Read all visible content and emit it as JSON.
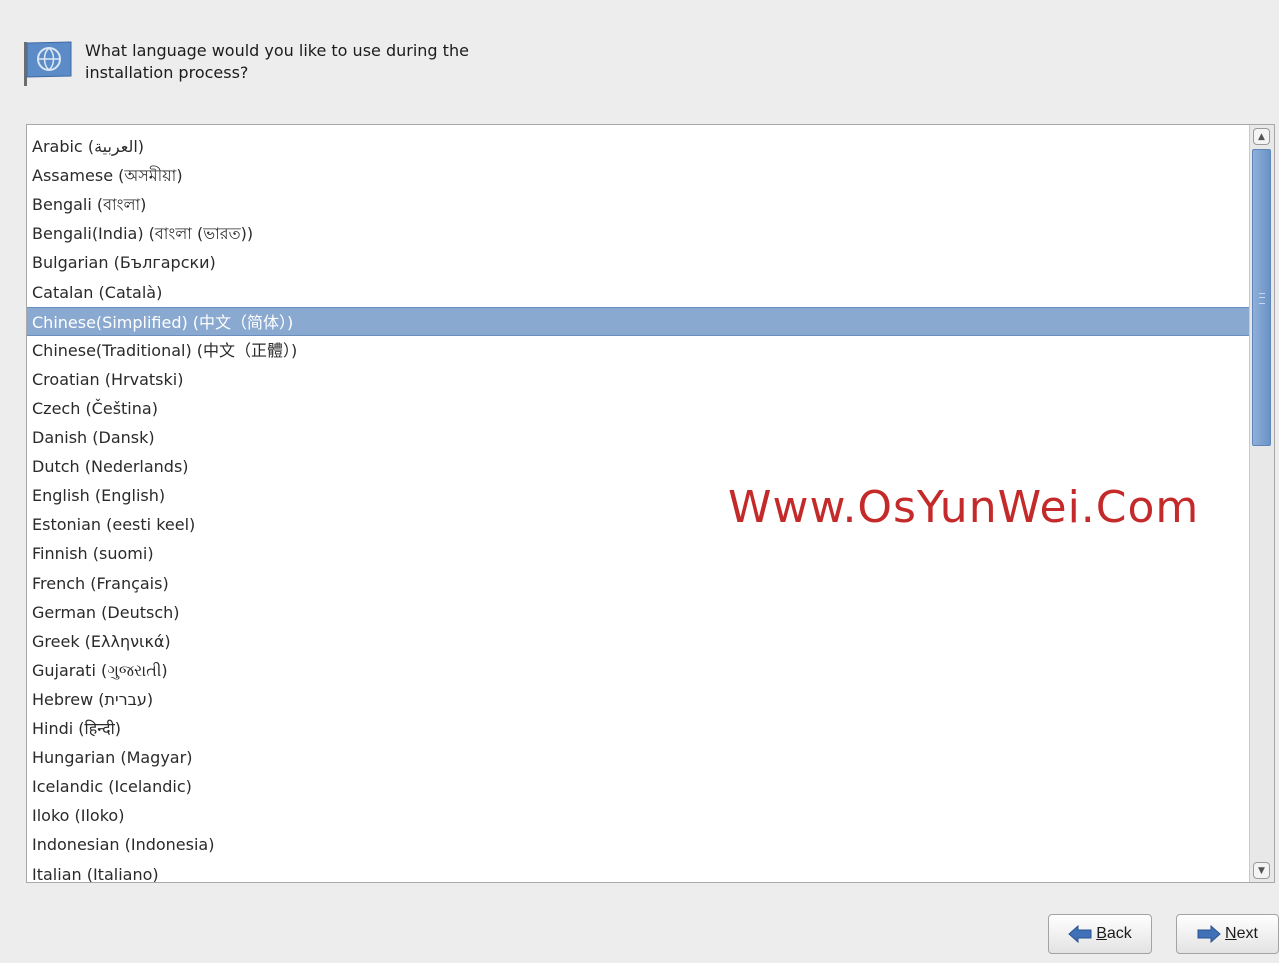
{
  "header": {
    "prompt": "What language would you like to use during the\ninstallation process?"
  },
  "language_list": {
    "items": [
      "Arabic (العربية)",
      "Assamese (অসমীয়া)",
      "Bengali (বাংলা)",
      "Bengali(India) (বাংলা (ভারত))",
      "Bulgarian (Български)",
      "Catalan (Català)",
      "Chinese(Simplified) (中文（简体）)",
      "Chinese(Traditional) (中文（正體）)",
      "Croatian (Hrvatski)",
      "Czech (Čeština)",
      "Danish (Dansk)",
      "Dutch (Nederlands)",
      "English (English)",
      "Estonian (eesti keel)",
      "Finnish (suomi)",
      "French (Français)",
      "German (Deutsch)",
      "Greek (Ελληνικά)",
      "Gujarati (ગુજરાતી)",
      "Hebrew (עברית)",
      "Hindi (हिन्दी)",
      "Hungarian (Magyar)",
      "Icelandic (Icelandic)",
      "Iloko (Iloko)",
      "Indonesian (Indonesia)",
      "Italian (Italiano)"
    ],
    "selected_index": 6,
    "selection_color": "#8aa9d0"
  },
  "watermark": "Www.OsYunWei.Com",
  "buttons": {
    "back": {
      "mnemonic": "B",
      "rest": "ack",
      "icon": "arrow-left-icon"
    },
    "next": {
      "mnemonic": "N",
      "rest": "ext",
      "icon": "arrow-right-icon"
    }
  },
  "colors": {
    "accent": "#6b92c6",
    "watermark": "#c42a2a"
  }
}
